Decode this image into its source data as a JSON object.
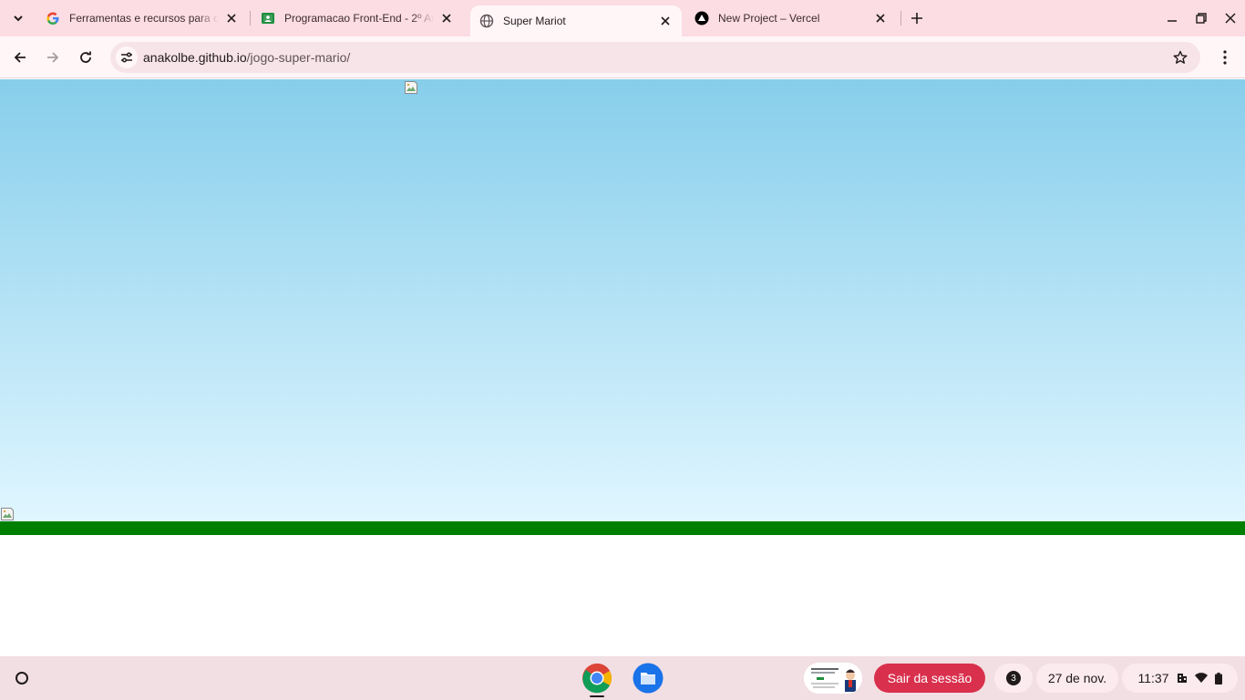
{
  "browser": {
    "tabs": [
      {
        "title": "Ferramentas e recursos para o",
        "favicon": "google-icon",
        "active": false
      },
      {
        "title": "Programacao Front-End - 2º Ano",
        "favicon": "classroom-icon",
        "active": false
      },
      {
        "title": "Super Mariot",
        "favicon": "globe-icon",
        "active": true
      },
      {
        "title": "New Project – Vercel",
        "favicon": "vercel-icon",
        "active": false
      }
    ],
    "url": {
      "host": "anakolbe.github.io",
      "path": "/jogo-super-mario/"
    }
  },
  "page": {
    "colors": {
      "sky_top": "#87ceeb",
      "sky_bottom": "#e0f6ff",
      "ground": "#008000"
    },
    "images": [
      "broken-image-icon",
      "broken-image-icon"
    ]
  },
  "shelf": {
    "apps": [
      "chrome-icon",
      "files-icon"
    ],
    "logout_label": "Sair da sessão",
    "notification_count": "3",
    "date": "27 de nov.",
    "time": "11:37",
    "status_icons": [
      "managed-device-icon",
      "wifi-icon",
      "battery-icon"
    ],
    "accent": "#d9304d"
  }
}
